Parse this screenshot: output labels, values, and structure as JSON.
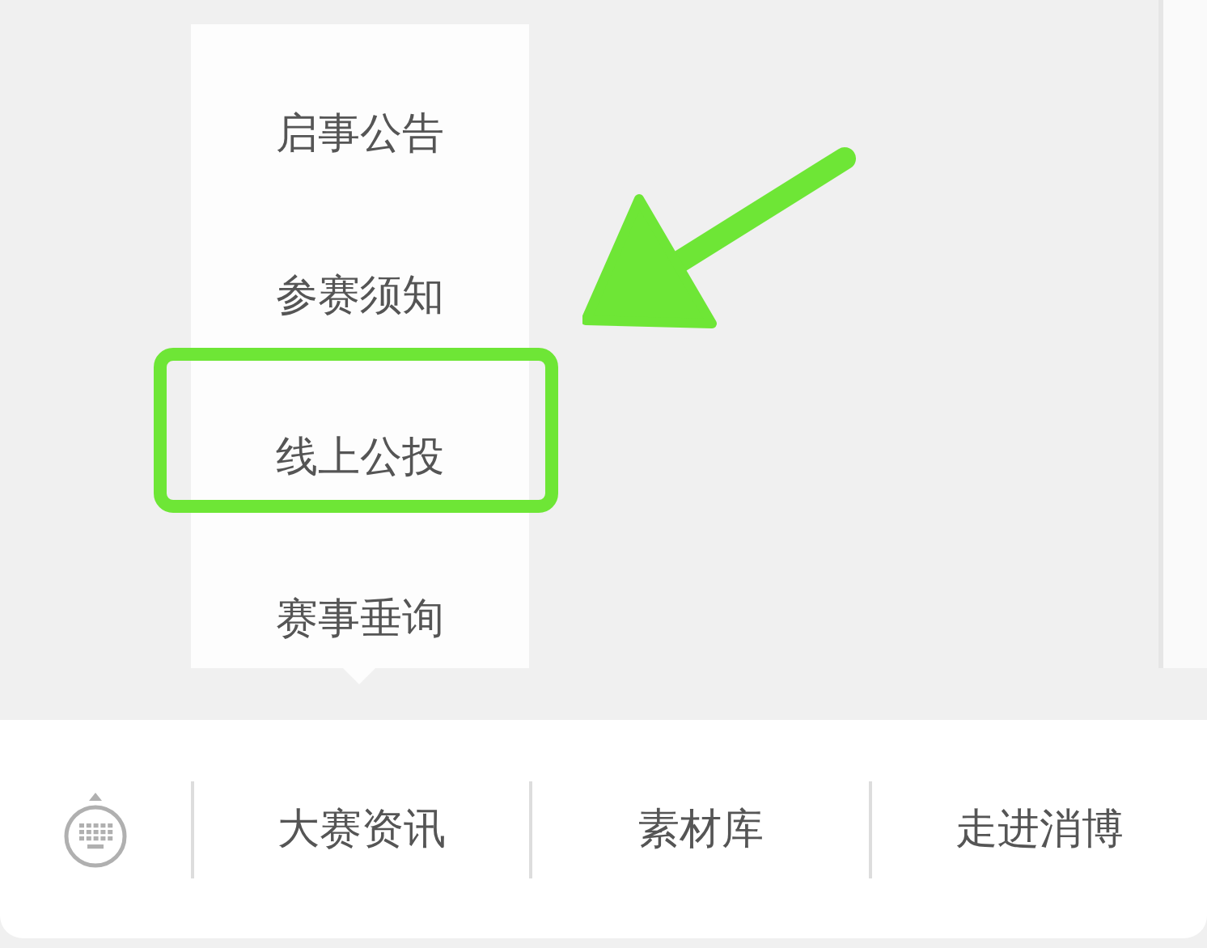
{
  "popup_menu": {
    "items": [
      {
        "label": "启事公告",
        "highlighted": false
      },
      {
        "label": "参赛须知",
        "highlighted": false
      },
      {
        "label": "线上公投",
        "highlighted": true
      },
      {
        "label": "赛事垂询",
        "highlighted": false
      }
    ]
  },
  "bottom_menu": {
    "items": [
      {
        "label": "大赛资讯"
      },
      {
        "label": "素材库"
      },
      {
        "label": "走进消博"
      }
    ]
  }
}
